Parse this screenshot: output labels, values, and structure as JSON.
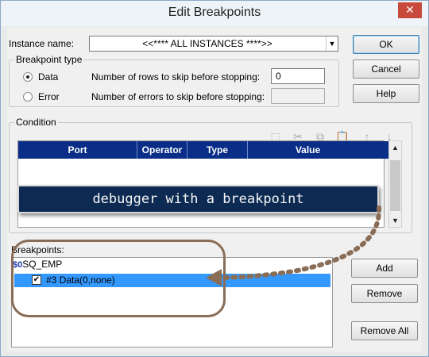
{
  "window": {
    "title": "Edit Breakpoints",
    "close_glyph": "✕"
  },
  "instance": {
    "label": "Instance name:",
    "value": "<<**** ALL INSTANCES ****>>"
  },
  "breakpoint_type": {
    "legend": "Breakpoint type",
    "data_label": "Data",
    "error_label": "Error",
    "rows_skip_label": "Number of rows to skip before stopping:",
    "rows_skip_value": "0",
    "errors_skip_label": "Number of errors to skip before stopping:",
    "errors_skip_value": ""
  },
  "condition": {
    "legend": "Condition",
    "toolbar_icons": [
      "new-condition-icon",
      "cut-icon",
      "copy-icon",
      "paste-icon",
      "move-up-icon",
      "move-down-icon"
    ],
    "columns": [
      "Port",
      "Operator",
      "Type",
      "Value"
    ]
  },
  "annotation": {
    "text": "debugger with a breakpoint",
    "arrow_color": "#8a6d56"
  },
  "breakpoints": {
    "label": "Breakpoints:",
    "items": [
      {
        "label": "SQ_EMP",
        "selected": false,
        "icon": "$0"
      },
      {
        "label": "#3 Data(0,none)",
        "selected": true,
        "checked": true
      }
    ]
  },
  "buttons": {
    "ok": "OK",
    "cancel": "Cancel",
    "help": "Help",
    "add": "Add",
    "remove": "Remove",
    "remove_all": "Remove All"
  },
  "colors": {
    "grid_header": "#0a2e88",
    "selection": "#3399ff",
    "banner": "#0c2a52"
  }
}
